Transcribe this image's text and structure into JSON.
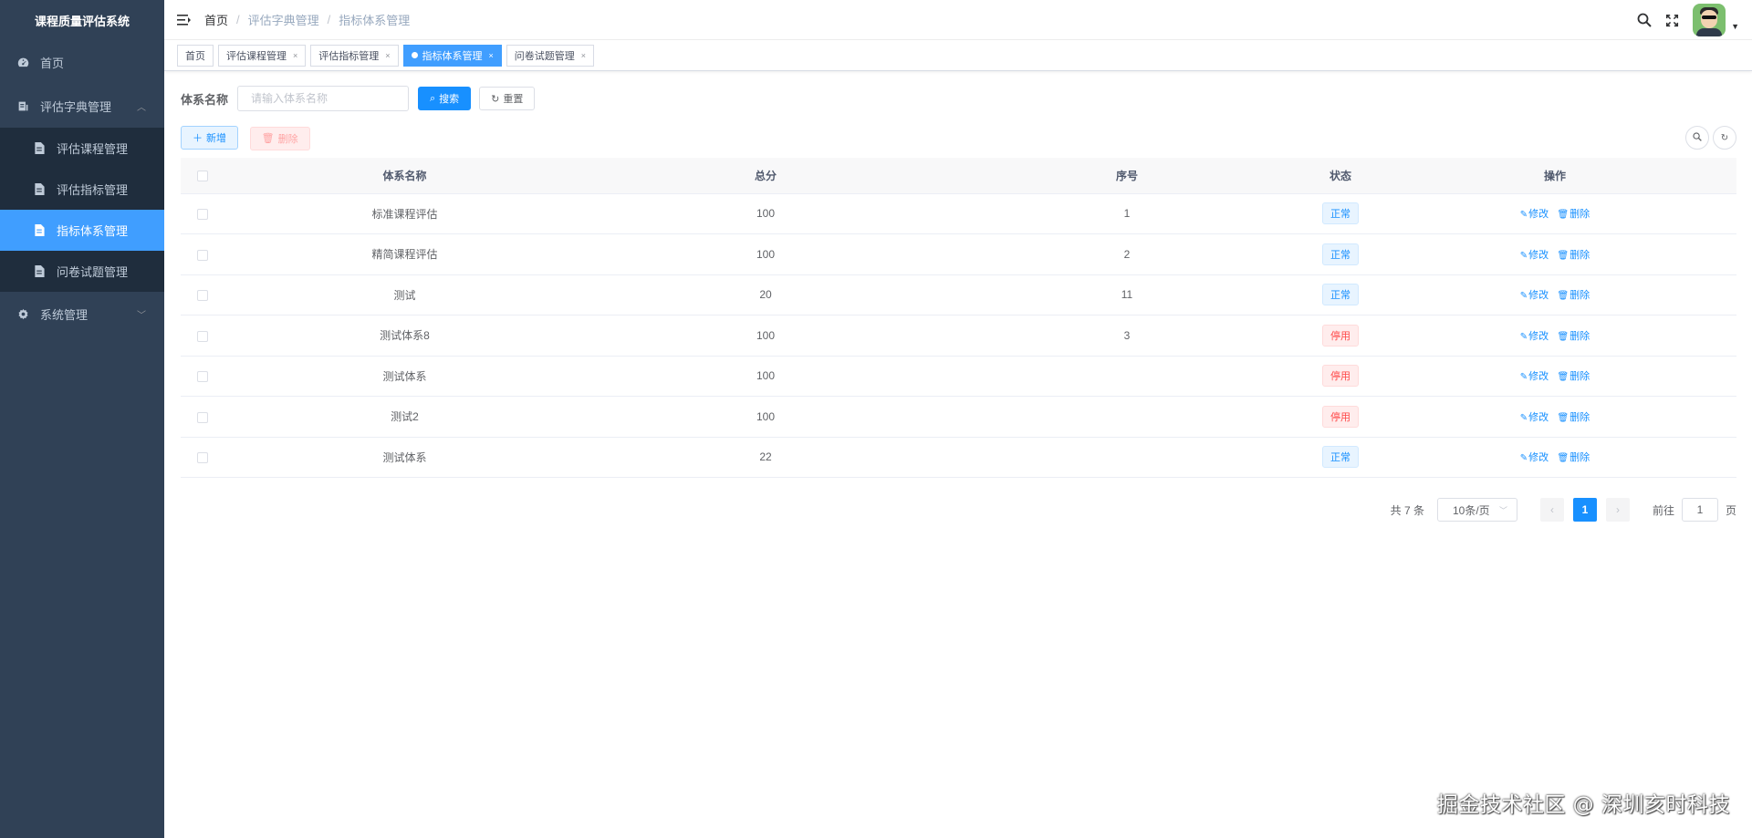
{
  "app": {
    "title": "课程质量评估系统"
  },
  "sidebar": {
    "items": [
      {
        "label": "首页",
        "icon": "dashboard-icon"
      },
      {
        "label": "评估字典管理",
        "icon": "dictionary-icon",
        "expanded": true,
        "children": [
          {
            "label": "评估课程管理",
            "icon": "document-icon"
          },
          {
            "label": "评估指标管理",
            "icon": "document-icon"
          },
          {
            "label": "指标体系管理",
            "icon": "document-icon",
            "active": true
          },
          {
            "label": "问卷试题管理",
            "icon": "document-icon"
          }
        ]
      },
      {
        "label": "系统管理",
        "icon": "gear-icon",
        "expanded": false
      }
    ]
  },
  "breadcrumb": [
    "首页",
    "评估字典管理",
    "指标体系管理"
  ],
  "tags": [
    {
      "label": "首页"
    },
    {
      "label": "评估课程管理",
      "closable": true
    },
    {
      "label": "评估指标管理",
      "closable": true
    },
    {
      "label": "指标体系管理",
      "closable": true,
      "active": true
    },
    {
      "label": "问卷试题管理",
      "closable": true
    }
  ],
  "search": {
    "label": "体系名称",
    "placeholder": "请输入体系名称",
    "value": "",
    "search_button": "搜索",
    "reset_button": "重置"
  },
  "toolbar": {
    "add_button": "新增",
    "delete_button": "删除"
  },
  "table": {
    "columns": [
      "体系名称",
      "总分",
      "序号",
      "状态",
      "操作"
    ],
    "rows": [
      {
        "name": "标准课程评估",
        "score": "100",
        "order": "1",
        "status": "正常",
        "status_type": "ok"
      },
      {
        "name": "精简课程评估",
        "score": "100",
        "order": "2",
        "status": "正常",
        "status_type": "ok"
      },
      {
        "name": "测试",
        "score": "20",
        "order": "11",
        "status": "正常",
        "status_type": "ok"
      },
      {
        "name": "测试体系8",
        "score": "100",
        "order": "3",
        "status": "停用",
        "status_type": "off"
      },
      {
        "name": "测试体系",
        "score": "100",
        "order": "",
        "status": "停用",
        "status_type": "off"
      },
      {
        "name": "测试2",
        "score": "100",
        "order": "",
        "status": "停用",
        "status_type": "off"
      },
      {
        "name": "测试体系",
        "score": "22",
        "order": "",
        "status": "正常",
        "status_type": "ok"
      }
    ],
    "actions": {
      "edit": "修改",
      "delete": "删除"
    }
  },
  "pagination": {
    "total_text": "共 7 条",
    "page_size": "10条/页",
    "current_page": "1",
    "goto_prefix": "前往",
    "goto_value": "1",
    "goto_suffix": "页"
  },
  "watermark": "掘金技术社区 @ 深圳亥时科技",
  "colors": {
    "primary": "#1890ff",
    "sidebar_bg": "#304156",
    "danger": "#ff4949"
  }
}
